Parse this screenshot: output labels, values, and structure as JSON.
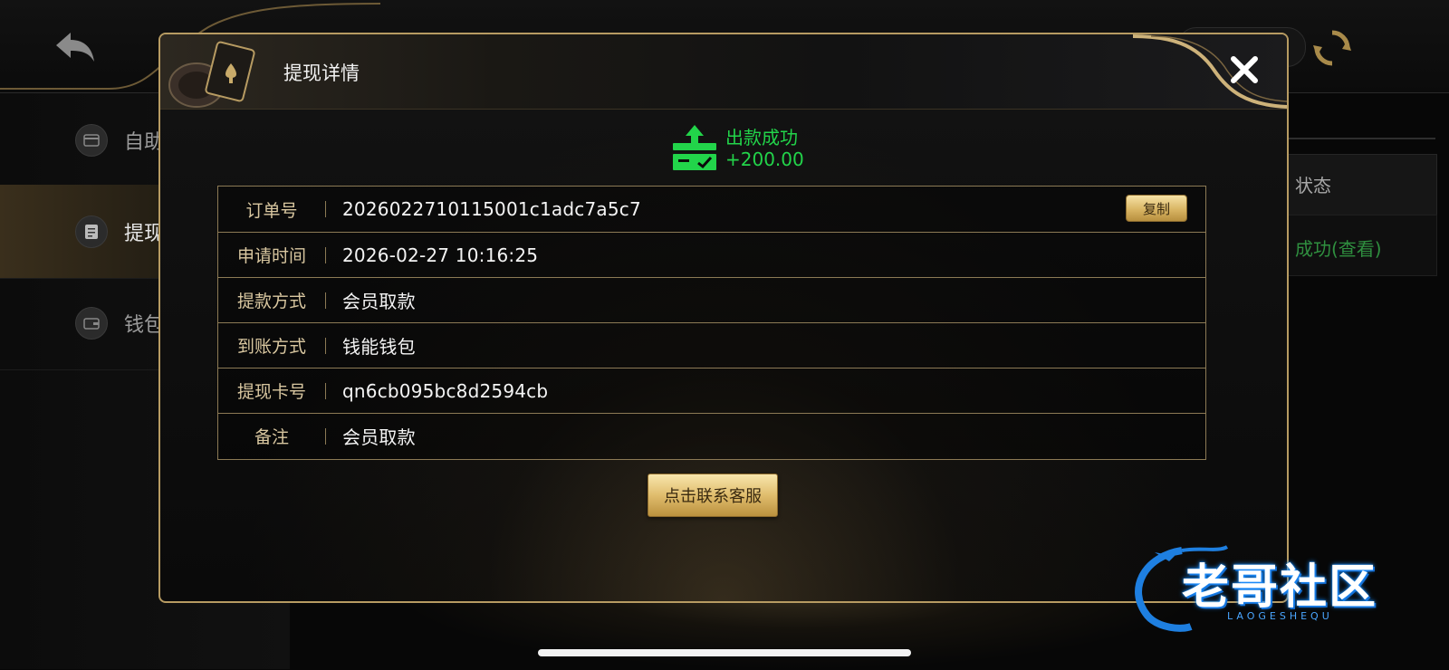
{
  "background": {
    "sidebar": {
      "items": [
        {
          "label": "自助",
          "icon": "card-icon"
        },
        {
          "label": "提现",
          "icon": "document-icon",
          "active": true
        },
        {
          "label": "钱包",
          "icon": "wallet-icon"
        }
      ]
    },
    "table": {
      "status_header": "状态",
      "status_value": "成功(查看)"
    }
  },
  "modal": {
    "title": "提现详情",
    "status": {
      "text": "出款成功",
      "amount": "+200.00",
      "color": "#22d44a"
    },
    "rows": [
      {
        "label": "订单号",
        "value": "2026022710115001c1adc7a5c7"
      },
      {
        "label": "申请时间",
        "value": "2026-02-27 10:16:25"
      },
      {
        "label": "提款方式",
        "value": "会员取款"
      },
      {
        "label": "到账方式",
        "value": "钱能钱包"
      },
      {
        "label": "提现卡号",
        "value": "qn6cb095bc8d2594cb"
      },
      {
        "label": "备注",
        "value": "会员取款"
      }
    ],
    "copy_label": "复制",
    "contact_label": "点击联系客服"
  },
  "watermark": {
    "text": "老哥社区",
    "sub": "LAOGESHEQU"
  },
  "colors": {
    "accent_gold": "#b79b62",
    "label_gold": "#d9c7a0",
    "success_green": "#22d44a"
  }
}
